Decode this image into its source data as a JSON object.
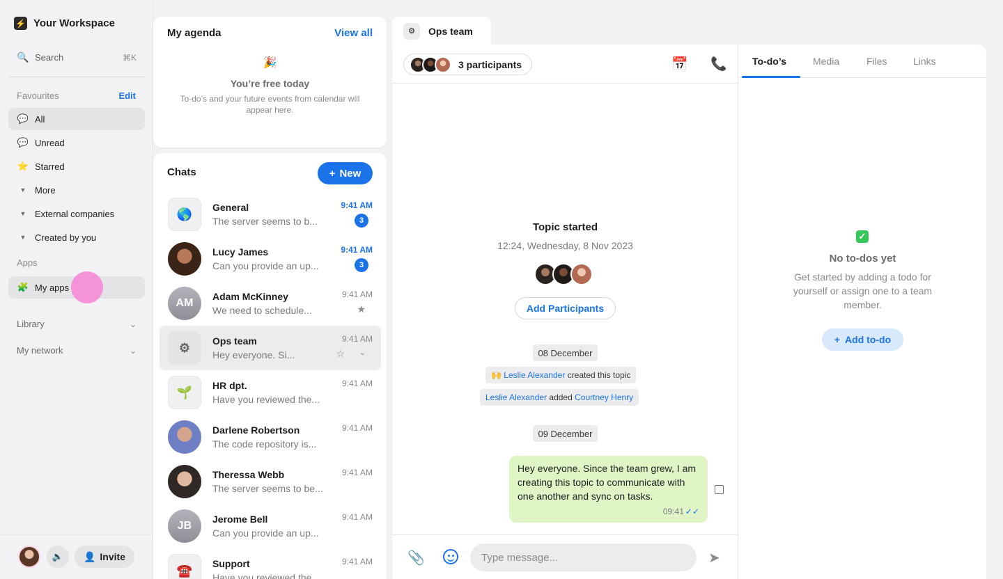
{
  "workspace": {
    "name": "Your Workspace"
  },
  "search": {
    "label": "Search",
    "shortcut": "⌘K"
  },
  "favourites": {
    "label": "Favourites",
    "edit": "Edit",
    "items": [
      {
        "label": "All",
        "icon": "chat-bubble-icon"
      },
      {
        "label": "Unread",
        "icon": "chat-bubble-unread-icon"
      },
      {
        "label": "Starred",
        "icon": "star-icon"
      },
      {
        "label": "More",
        "icon": "caret-down-icon"
      },
      {
        "label": "External companies",
        "icon": "caret-down-icon"
      },
      {
        "label": "Created by you",
        "icon": "caret-down-icon"
      }
    ]
  },
  "apps": {
    "label": "Apps",
    "my_apps": "My apps"
  },
  "library": {
    "label": "Library"
  },
  "network": {
    "label": "My network"
  },
  "footer": {
    "invite": "Invite"
  },
  "agenda": {
    "title": "My agenda",
    "view_all": "View all",
    "empty_title": "You’re free today",
    "empty_sub": "To-do’s and your future events from calendar will appear here."
  },
  "chats": {
    "title": "Chats",
    "new": "New",
    "items": [
      {
        "name": "General",
        "preview": "The server seems to b...",
        "time": "9:41 AM",
        "badge": "3"
      },
      {
        "name": "Lucy James",
        "preview": "Can you provide an up...",
        "time": "9:41 AM",
        "badge": "3"
      },
      {
        "name": "Adam McKinney",
        "initials": "AM",
        "preview": "We need to schedule...",
        "time": "9:41 AM"
      },
      {
        "name": "Ops team",
        "preview": "Hey everyone. Si...",
        "time": "9:41 AM"
      },
      {
        "name": "HR dpt.",
        "preview": "Have you reviewed the...",
        "time": "9:41 AM"
      },
      {
        "name": "Darlene Robertson",
        "preview": "The code repository is...",
        "time": "9:41 AM"
      },
      {
        "name": "Theressa Webb",
        "preview": "The server seems to be...",
        "time": "9:41 AM"
      },
      {
        "name": "Jerome Bell",
        "initials": "JB",
        "preview": "Can you provide an up...",
        "time": "9:41 AM"
      },
      {
        "name": "Support",
        "preview": "Have you reviewed the...",
        "time": "9:41 AM"
      }
    ]
  },
  "conversation": {
    "tab": "Ops team",
    "participants": "3 participants",
    "topic_title": "Topic started",
    "topic_date": "12:24, Wednesday, 8 Nov 2023",
    "add_participants": "Add Participants",
    "date1": "08 December",
    "sys1_actor": "Leslie Alexander",
    "sys1_text": "created this topic",
    "sys2_actor": "Leslie Alexander",
    "sys2_text": "added",
    "sys2_target": "Courtney Henry",
    "date2": "09 December",
    "message": "Hey everyone. Since the team grew, I am creating this topic to communicate with one another and sync on tasks.",
    "message_time": "09:41",
    "composer_placeholder": "Type message..."
  },
  "right": {
    "tabs": [
      "To-do’s",
      "Media",
      "Files",
      "Links"
    ],
    "empty_title": "No to-dos yet",
    "empty_sub": "Get started by adding a todo for yourself or assign one to a team member.",
    "add": "Add to-do"
  },
  "colors": {
    "accent": "#1a73e8",
    "bubble": "#dff5c6",
    "pointer": "#f48ed6"
  }
}
